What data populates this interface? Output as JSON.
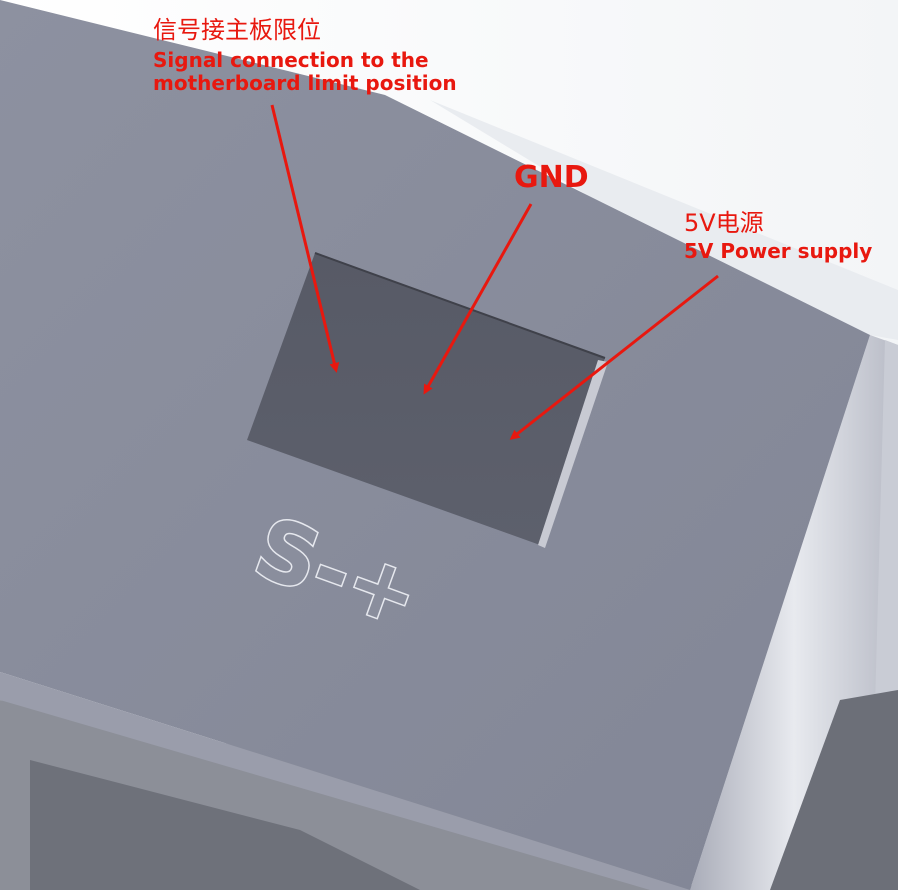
{
  "annotations": {
    "signal": {
      "label_cn": "信号接主板限位",
      "label_en_line1": "Signal connection to the",
      "label_en_line2": "motherboard limit position"
    },
    "gnd": {
      "label": "GND"
    },
    "power": {
      "label_cn": "5V电源",
      "label_en": "5V Power supply"
    }
  },
  "embossed_marking": {
    "text": "S-+"
  },
  "colors": {
    "annotation": "#e8180f",
    "arrow": "#e8180f",
    "housing_top": "#878b9a",
    "connector_opening": "#5a5d69",
    "background": "#ffffff"
  }
}
